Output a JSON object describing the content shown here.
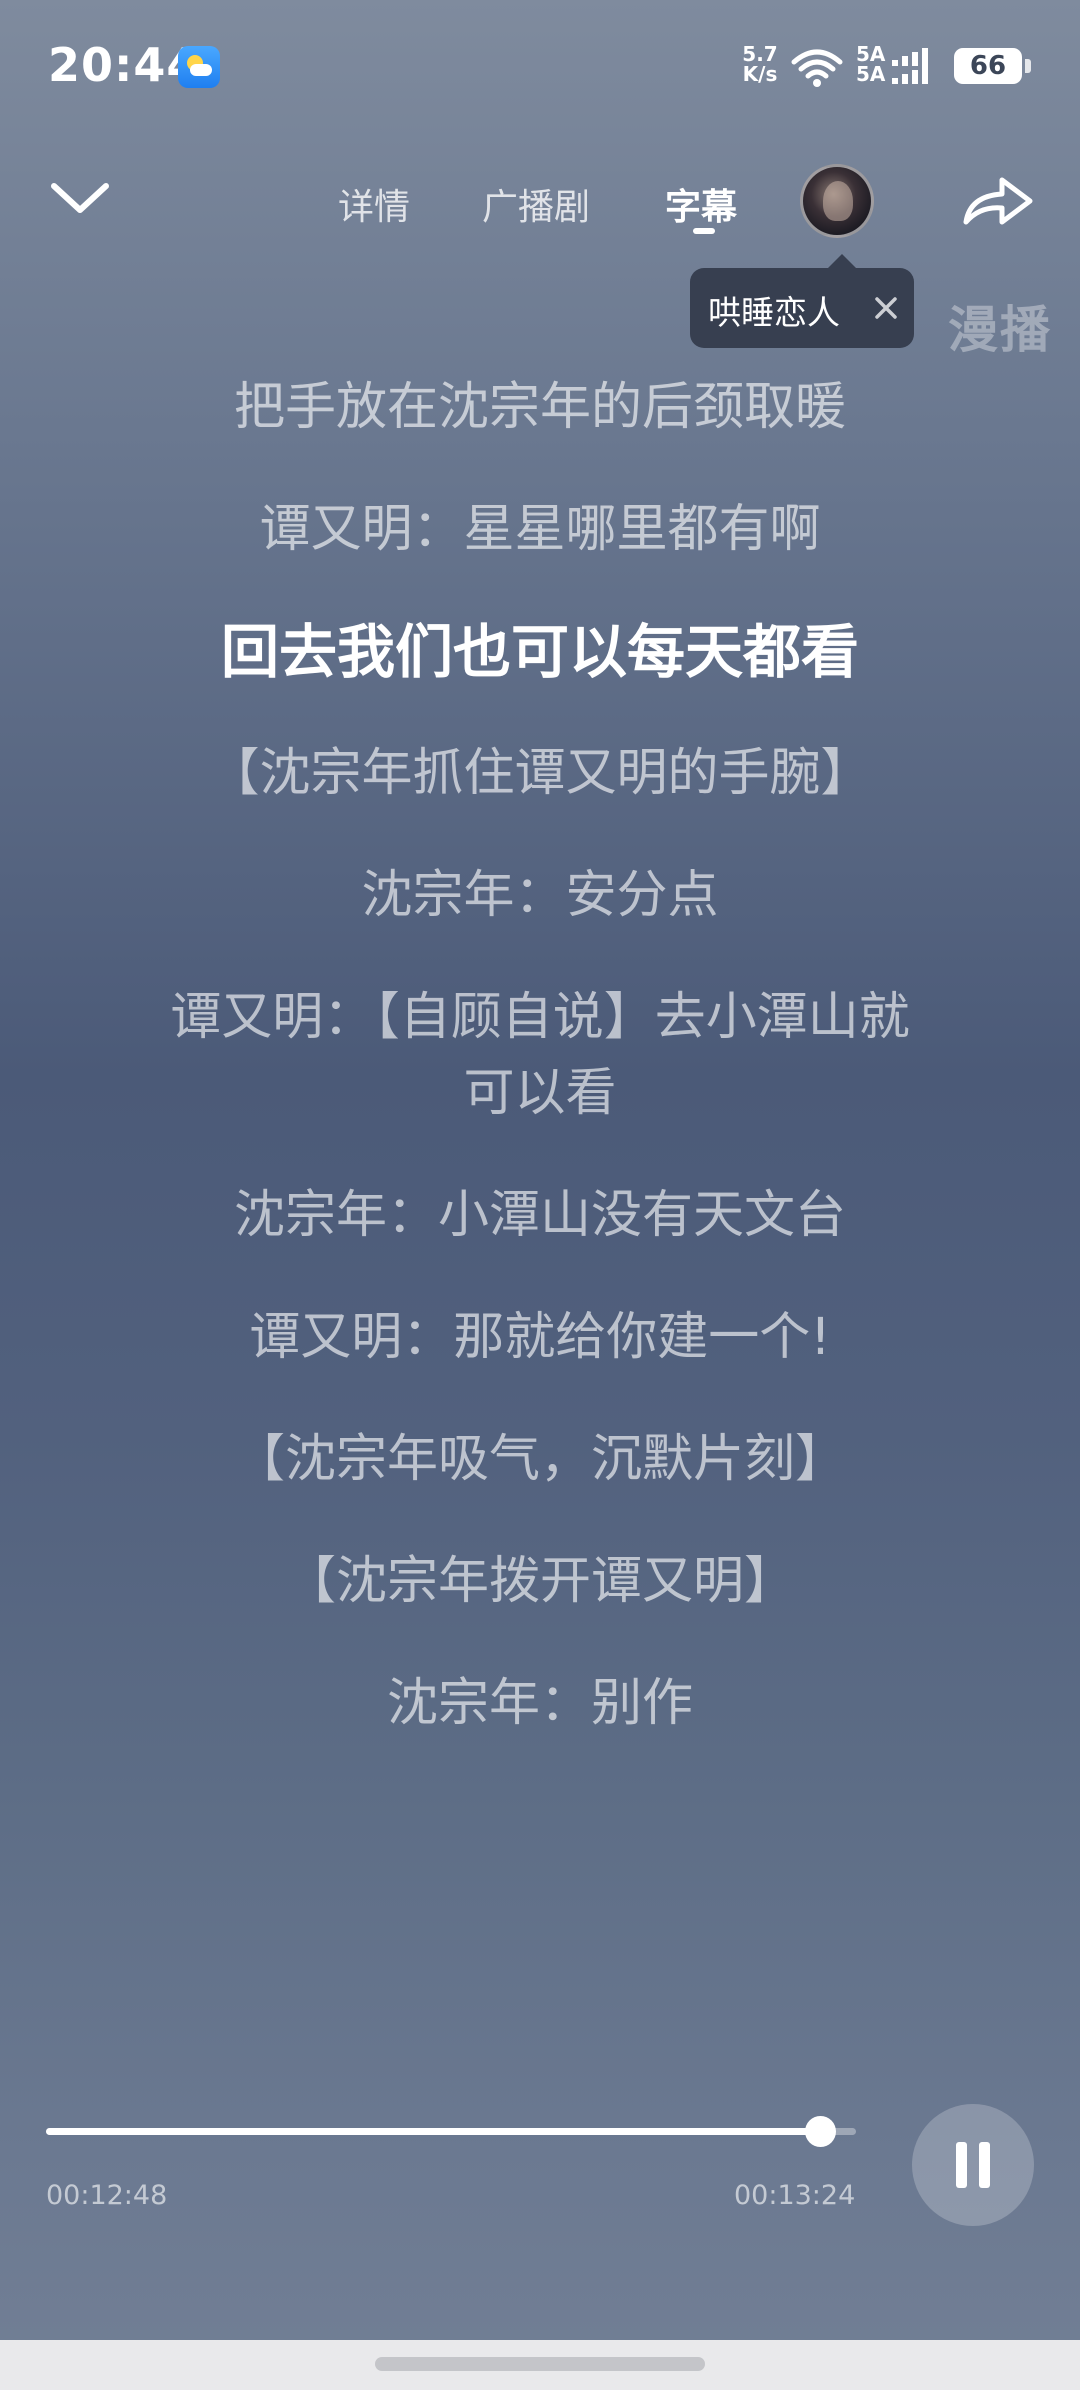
{
  "status_bar": {
    "time": "20:44",
    "net_speed_value": "5.7",
    "net_speed_unit": "K/s",
    "signal_label_1": "5A",
    "signal_label_2": "5A",
    "battery": "66"
  },
  "nav": {
    "tabs": [
      {
        "label": "详情"
      },
      {
        "label": "广播剧"
      },
      {
        "label": "字幕"
      }
    ],
    "active_tab": "字幕"
  },
  "tooltip": {
    "text": "哄睡恋人"
  },
  "manbo_label": "漫播",
  "lyrics": [
    {
      "text": "把手放在沈宗年的后颈取暖"
    },
    {
      "text": "谭又明：星星哪里都有啊"
    },
    {
      "text": "回去我们也可以每天都看"
    },
    {
      "text": "【沈宗年抓住谭又明的手腕】"
    },
    {
      "text": "沈宗年：安分点"
    },
    {
      "text": "谭又明：【自顾自说】去小潭山就可以看"
    },
    {
      "text": "沈宗年：小潭山没有天文台"
    },
    {
      "text": "谭又明：那就给你建一个!"
    },
    {
      "text": "【沈宗年吸气，沉默片刻】"
    },
    {
      "text": "【沈宗年拨开谭又明】"
    },
    {
      "text": "沈宗年：别作"
    }
  ],
  "player": {
    "current_time": "00:12:48",
    "total_time": "00:13:24",
    "progress": 0.955
  },
  "colors": {
    "accent": "#ffffff",
    "tooltip_bg": "#323a4a"
  }
}
